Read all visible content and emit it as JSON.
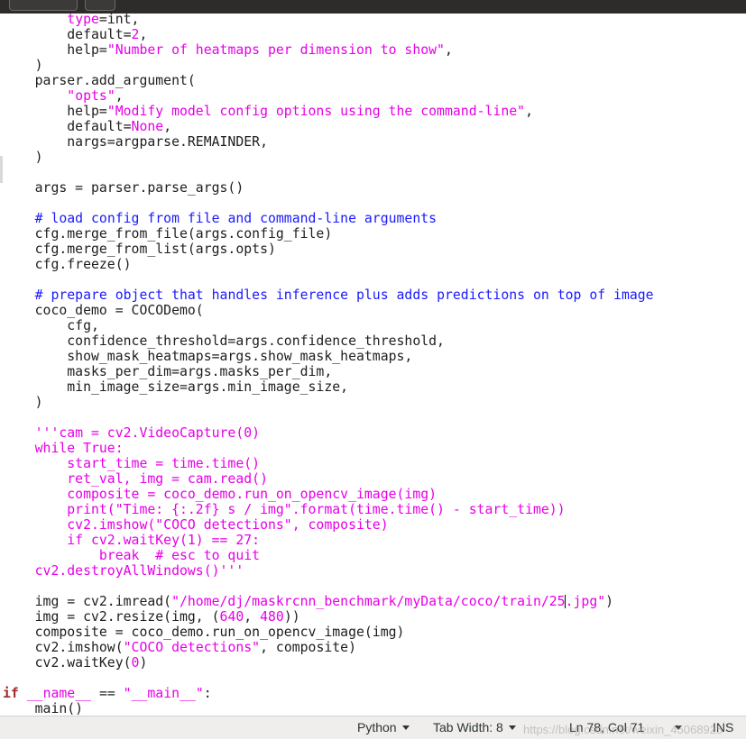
{
  "editor": {
    "lines": [
      [
        {
          "t": "        "
        },
        {
          "t": "type",
          "c": "s"
        },
        {
          "t": "=int,"
        }
      ],
      [
        {
          "t": "        default="
        },
        {
          "t": "2",
          "c": "n"
        },
        {
          "t": ","
        }
      ],
      [
        {
          "t": "        help="
        },
        {
          "t": "\"Number of heatmaps per dimension to show\"",
          "c": "s"
        },
        {
          "t": ","
        }
      ],
      [
        {
          "t": "    )"
        }
      ],
      [
        {
          "t": "    parser.add_argument("
        }
      ],
      [
        {
          "t": "        "
        },
        {
          "t": "\"opts\"",
          "c": "s"
        },
        {
          "t": ","
        }
      ],
      [
        {
          "t": "        help="
        },
        {
          "t": "\"Modify model config options using the command-line\"",
          "c": "s"
        },
        {
          "t": ","
        }
      ],
      [
        {
          "t": "        default="
        },
        {
          "t": "None",
          "c": "n"
        },
        {
          "t": ","
        }
      ],
      [
        {
          "t": "        nargs=argparse.REMAINDER,"
        }
      ],
      [
        {
          "t": "    )"
        }
      ],
      [
        {
          "t": ""
        }
      ],
      [
        {
          "t": "    args = parser.parse_args()"
        }
      ],
      [
        {
          "t": ""
        }
      ],
      [
        {
          "t": "    "
        },
        {
          "t": "# load config from file and command-line arguments",
          "c": "c"
        }
      ],
      [
        {
          "t": "    cfg.merge_from_file(args.config_file)"
        }
      ],
      [
        {
          "t": "    cfg.merge_from_list(args.opts)"
        }
      ],
      [
        {
          "t": "    cfg.freeze()"
        }
      ],
      [
        {
          "t": ""
        }
      ],
      [
        {
          "t": "    "
        },
        {
          "t": "# prepare object that handles inference plus adds predictions on top of image",
          "c": "c"
        }
      ],
      [
        {
          "t": "    coco_demo = COCODemo("
        }
      ],
      [
        {
          "t": "        cfg,"
        }
      ],
      [
        {
          "t": "        confidence_threshold=args.confidence_threshold,"
        }
      ],
      [
        {
          "t": "        show_mask_heatmaps=args.show_mask_heatmaps,"
        }
      ],
      [
        {
          "t": "        masks_per_dim=args.masks_per_dim,"
        }
      ],
      [
        {
          "t": "        min_image_size=args.min_image_size,"
        }
      ],
      [
        {
          "t": "    )"
        }
      ],
      [
        {
          "t": ""
        }
      ],
      [
        {
          "t": "    '''cam = cv2.VideoCapture(0)",
          "c": "s"
        }
      ],
      [
        {
          "t": "    while True:",
          "c": "s"
        }
      ],
      [
        {
          "t": "        start_time = time.time()",
          "c": "s"
        }
      ],
      [
        {
          "t": "        ret_val, img = cam.read()",
          "c": "s"
        }
      ],
      [
        {
          "t": "        composite = coco_demo.run_on_opencv_image(img)",
          "c": "s"
        }
      ],
      [
        {
          "t": "        print(\"Time: {:.2f} s / img\".format(time.time() - start_time))",
          "c": "s"
        }
      ],
      [
        {
          "t": "        cv2.imshow(\"COCO detections\", composite)",
          "c": "s"
        }
      ],
      [
        {
          "t": "        if cv2.waitKey(1) == 27:",
          "c": "s"
        }
      ],
      [
        {
          "t": "            break  # esc to quit",
          "c": "s"
        }
      ],
      [
        {
          "t": "    cv2.destroyAllWindows()'''",
          "c": "s"
        }
      ],
      [
        {
          "t": ""
        }
      ],
      [
        {
          "t": "    img = cv2.imread("
        },
        {
          "t": "\"/home/dj/maskrcnn_benchmark/myData/coco/train/25",
          "c": "s"
        },
        {
          "caret": true
        },
        {
          "t": ".jpg\"",
          "c": "s"
        },
        {
          "t": ")"
        }
      ],
      [
        {
          "t": "    img = cv2.resize(img, ("
        },
        {
          "t": "640",
          "c": "n"
        },
        {
          "t": ", "
        },
        {
          "t": "480",
          "c": "n"
        },
        {
          "t": "))"
        }
      ],
      [
        {
          "t": "    composite = coco_demo.run_on_opencv_image(img)"
        }
      ],
      [
        {
          "t": "    cv2.imshow("
        },
        {
          "t": "\"COCO detections\"",
          "c": "s"
        },
        {
          "t": ", composite)"
        }
      ],
      [
        {
          "t": "    cv2.waitKey("
        },
        {
          "t": "0",
          "c": "n"
        },
        {
          "t": ")"
        }
      ],
      [
        {
          "t": ""
        }
      ],
      [
        {
          "t": "if",
          "c": "k"
        },
        {
          "t": " "
        },
        {
          "t": "__name__",
          "c": "s"
        },
        {
          "t": " == "
        },
        {
          "t": "\"__main__\"",
          "c": "s"
        },
        {
          "t": ":"
        }
      ],
      [
        {
          "t": "    main()"
        }
      ]
    ]
  },
  "statusbar": {
    "language": "Python",
    "tab_width": "Tab Width: 8",
    "position": "Ln 78, Col 71",
    "mode": "INS",
    "watermark": "https://blog.csdn.net/weixin_45068925"
  },
  "colors": {
    "string": "#e600e6",
    "keyword": "#a52a2a",
    "comment": "#1a1aff",
    "text": "#1e1e1e"
  }
}
